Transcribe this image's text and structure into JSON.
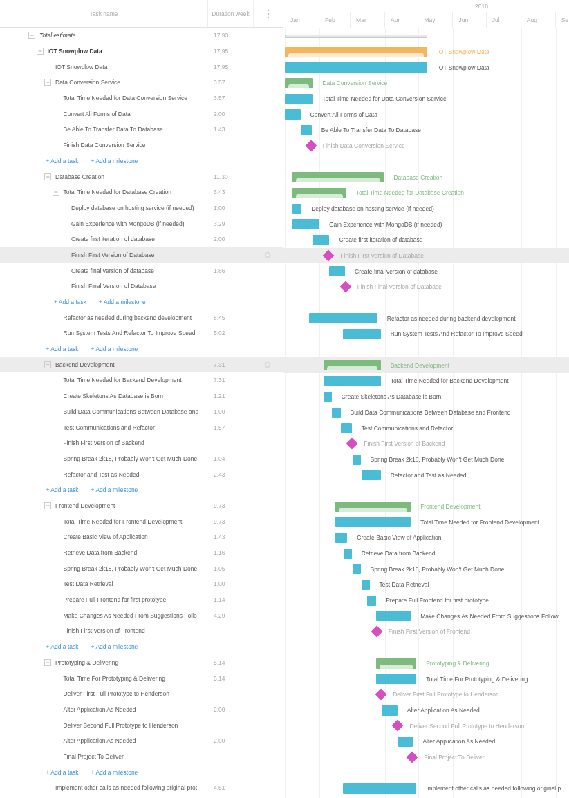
{
  "header": {
    "task_name": "Task name",
    "duration": "Duration week",
    "year": "2018",
    "months": [
      "Jan",
      "Feb",
      "Mar",
      "Apr",
      "May",
      "Jun",
      "Jul",
      "Aug",
      "Se"
    ]
  },
  "tasks": [
    {
      "kind": "summary",
      "name": "Total estimate",
      "duration": "17.93",
      "hovered": false,
      "expanded": true,
      "children": [
        {
          "kind": "project",
          "name": "IOT Snowplow Data",
          "duration": "17.95",
          "bar_label": "IOT Snowplow Data",
          "color": "#f5b55f",
          "hovered": false,
          "expanded": true,
          "children": [
            {
              "kind": "task",
              "name": "IOT Snowplow Data",
              "duration": "17.95",
              "bar_label": "IOT Snowplow Data",
              "hovered": false
            },
            {
              "kind": "group",
              "name": "Data Conversion Service",
              "duration": "3.57",
              "bar_label": "Data Conversion Service",
              "color": "#7dba7e",
              "hovered": false,
              "expanded": true,
              "add_links": [
                "+ Add a task",
                "+ Add a milestone"
              ],
              "children": [
                {
                  "kind": "task",
                  "name": "Total Time Needed for Data Conversion Service",
                  "duration": "3.57",
                  "bar_label": "Total Time Needed for Data Conversion Service",
                  "hovered": false
                },
                {
                  "kind": "task",
                  "name": "Convert All Forms of Data",
                  "duration": "2.00",
                  "bar_label": "Convert All Forms of Data",
                  "hovered": false
                },
                {
                  "kind": "task",
                  "name": "Be Able To Transfer Data To Database",
                  "duration": "1.43",
                  "bar_label": "Be Able To Transfer Data To Database",
                  "hovered": false
                },
                {
                  "kind": "milestone",
                  "name": "Finish Data Conversion Service",
                  "bar_label": "Finish Data Conversion Service",
                  "hovered": false
                }
              ]
            },
            {
              "kind": "group",
              "name": "Database Creation",
              "duration": "11.30",
              "bar_label": "Database Creation",
              "color": "#7dba7e",
              "hovered": false,
              "expanded": true,
              "add_links": [
                "+ Add a task",
                "+ Add a milestone"
              ],
              "children": [
                {
                  "kind": "group",
                  "name": "Total Time Needed for Database Creation",
                  "duration": "6.43",
                  "bar_label": "Total Time Needed for Database Creation",
                  "color": "#7dba7e",
                  "hovered": false,
                  "expanded": true,
                  "add_links": [
                    "+ Add a task",
                    "+ Add a milestone"
                  ],
                  "children": [
                    {
                      "kind": "task",
                      "name": "Deploy database on hosting service (if needed)",
                      "duration": "1.00",
                      "bar_label": "Deploy database on hosting service (if needed)",
                      "hovered": false
                    },
                    {
                      "kind": "task",
                      "name": "Gain Experience with MongoDB (if needed)",
                      "duration": "3.29",
                      "bar_label": "Gain Experience with MongoDB (if needed)",
                      "hovered": false
                    },
                    {
                      "kind": "task",
                      "name": "Create first iteration of database",
                      "duration": "2.00",
                      "bar_label": "Create first iteration of database",
                      "hovered": false
                    },
                    {
                      "kind": "milestone",
                      "name": "Finish First Version of Database",
                      "bar_label": "Finish First Version of Database",
                      "hovered": true
                    },
                    {
                      "kind": "task",
                      "name": "Create final version of database",
                      "duration": "1.86",
                      "bar_label": "Create final version of database",
                      "hovered": false
                    },
                    {
                      "kind": "milestone",
                      "name": "Finish Final Version of Database",
                      "bar_label": "Finish Final Version of Database",
                      "hovered": false
                    }
                  ]
                },
                {
                  "kind": "task",
                  "name": "Refactor as needed during backend development",
                  "duration": "8.45",
                  "bar_label": "Refactor as needed during backend development",
                  "hovered": false
                },
                {
                  "kind": "task",
                  "name": "Run System Tests And Refactor To Improve Speed",
                  "duration": "5.02",
                  "bar_label": "Run System Tests And Refactor To Improve Speed",
                  "hovered": false
                }
              ]
            },
            {
              "kind": "group",
              "name": "Backend Development",
              "duration": "7.31",
              "bar_label": "Backend Development",
              "color": "#7dba7e",
              "hovered": true,
              "expanded": true,
              "add_links": [
                "+ Add a task",
                "+ Add a milestone"
              ],
              "children": [
                {
                  "kind": "task",
                  "name": "Total Time Needed for Backend Development",
                  "duration": "7.31",
                  "bar_label": "Total Time Needed for Backend Development",
                  "hovered": false
                },
                {
                  "kind": "task",
                  "name": "Create Skeletons As Database is Born",
                  "duration": "1.21",
                  "bar_label": "Create Skeletons As Database is Born",
                  "hovered": false
                },
                {
                  "kind": "task",
                  "name": "Build Data Communications Between Database and",
                  "duration": "1.00",
                  "bar_label": "Build Data Communications Between Database and Frontend",
                  "hovered": false
                },
                {
                  "kind": "task",
                  "name": "Test Communications and Refactor",
                  "duration": "1.57",
                  "bar_label": "Test Communications and Refactor",
                  "hovered": false
                },
                {
                  "kind": "milestone",
                  "name": "Finish First Version of Backend",
                  "bar_label": "Finish First Version of Backend",
                  "hovered": false
                },
                {
                  "kind": "task",
                  "name": "Spring Break 2k18, Probably Won't Get Much Done",
                  "duration": "1.04",
                  "bar_label": "Spring Break 2k18, Probably Won't Get Much Done",
                  "hovered": false
                },
                {
                  "kind": "task",
                  "name": "Refactor and Test as Needed",
                  "duration": "2.43",
                  "bar_label": "Refactor and Test as Needed",
                  "hovered": false
                }
              ]
            },
            {
              "kind": "group",
              "name": "Frontend Development",
              "duration": "9.73",
              "bar_label": "Frontend Development",
              "color": "#7dba7e",
              "hovered": false,
              "expanded": true,
              "add_links": [
                "+ Add a task",
                "+ Add a milestone"
              ],
              "children": [
                {
                  "kind": "task",
                  "name": "Total Time Needed for Frontend Development",
                  "duration": "9.73",
                  "bar_label": "Total Time Needed for Frontend Development",
                  "hovered": false
                },
                {
                  "kind": "task",
                  "name": "Create Basic View of Application",
                  "duration": "1.43",
                  "bar_label": "Create Basic View of Application",
                  "hovered": false
                },
                {
                  "kind": "task",
                  "name": "Retrieve Data from Backend",
                  "duration": "1.16",
                  "bar_label": "Retrieve Data from Backend",
                  "hovered": false
                },
                {
                  "kind": "task",
                  "name": "Spring Break 2k18, Probably Won't Get Much Done",
                  "duration": "1.05",
                  "bar_label": "Spring Break 2k18, Probably Won't Get Much Done",
                  "hovered": false
                },
                {
                  "kind": "task",
                  "name": "Test Data Retrieval",
                  "duration": "1.00",
                  "bar_label": "Test Data Retrieval",
                  "hovered": false
                },
                {
                  "kind": "task",
                  "name": "Prepare Full Frontend for first prototype",
                  "duration": "1.14",
                  "bar_label": "Prepare Full Frontend for first prototype",
                  "hovered": false
                },
                {
                  "kind": "task",
                  "name": "Make Changes As Needed From Suggestions Follo",
                  "duration": "4.29",
                  "bar_label": "Make Changes As Needed From Suggestions Followi",
                  "hovered": false
                },
                {
                  "kind": "milestone",
                  "name": "Finish First Version of Frontend",
                  "bar_label": "Finish First Version of Frontend",
                  "hovered": false
                }
              ]
            },
            {
              "kind": "group",
              "name": "Prototyping & Delivering",
              "duration": "5.14",
              "bar_label": "Prototyping & Delivering",
              "color": "#7dba7e",
              "hovered": false,
              "expanded": true,
              "add_links": [
                "+ Add a task",
                "+ Add a milestone"
              ],
              "children": [
                {
                  "kind": "task",
                  "name": "Total Time For Prototyping & Delivering",
                  "duration": "5.14",
                  "bar_label": "Total Time For Prototyping & Delivering",
                  "hovered": false
                },
                {
                  "kind": "milestone",
                  "name": "Deliver First Full Prototype to Henderson",
                  "bar_label": "Deliver First Full Prototype to Henderson",
                  "hovered": false
                },
                {
                  "kind": "task",
                  "name": "Alter Application As Needed",
                  "duration": "2.00",
                  "bar_label": "Alter Application As Needed",
                  "hovered": false
                },
                {
                  "kind": "milestone",
                  "name": "Deliver Second Full Prototype to Henderson",
                  "bar_label": "Deliver Second Full Prototype to Henderson",
                  "hovered": false
                },
                {
                  "kind": "task",
                  "name": "Alter Application As Needed",
                  "duration": "2.00",
                  "bar_label": "Alter Application As Needed",
                  "hovered": false
                },
                {
                  "kind": "milestone",
                  "name": "Final Project To Deliver",
                  "bar_label": "Final Project To Deliver",
                  "hovered": false
                }
              ]
            },
            {
              "kind": "task",
              "name": "Implement other calls as needed following original prot",
              "duration": "4.51",
              "bar_label": "Implement other calls as needed following original p",
              "hovered": false
            }
          ]
        }
      ]
    }
  ]
}
